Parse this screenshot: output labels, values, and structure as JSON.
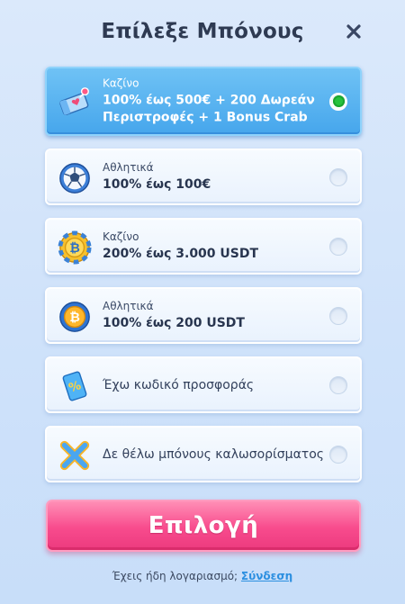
{
  "header": {
    "title": "Επίλεξε Μπόνους",
    "close_icon": "close-icon"
  },
  "bonuses": [
    {
      "category": "Καζίνο",
      "line1": "100% έως 500€ + 200 Δωρεάν",
      "line2": "Περιστροφές + 1 Bonus Crab",
      "icon": "ticket-heart-icon",
      "selected": true
    },
    {
      "category": "Αθλητικά",
      "line1": "100% έως 100€",
      "icon": "soccer-ball-icon",
      "selected": false
    },
    {
      "category": "Καζίνο",
      "line1": "200% έως 3.000 USDT",
      "icon": "bitcoin-chip-icon",
      "selected": false
    },
    {
      "category": "Αθλητικά",
      "line1": "100% έως 200 USDT",
      "icon": "bitcoin-ball-icon",
      "selected": false
    },
    {
      "label": "Έχω κωδικό προσφοράς",
      "icon": "promo-code-ticket-icon",
      "selected": false
    },
    {
      "label": "Δε θέλω μπόνους καλωσορίσματος",
      "icon": "x-mark-icon",
      "selected": false
    }
  ],
  "cta": {
    "label": "Επιλογή"
  },
  "footer": {
    "text": "Έχεις ήδη λογαριασμό;",
    "link": "Σύνδεση"
  },
  "colors": {
    "selected_card": "#46a6ec",
    "cta": "#f84b8d",
    "radio_selected": "#27c23e",
    "link": "#2c8fe0"
  }
}
